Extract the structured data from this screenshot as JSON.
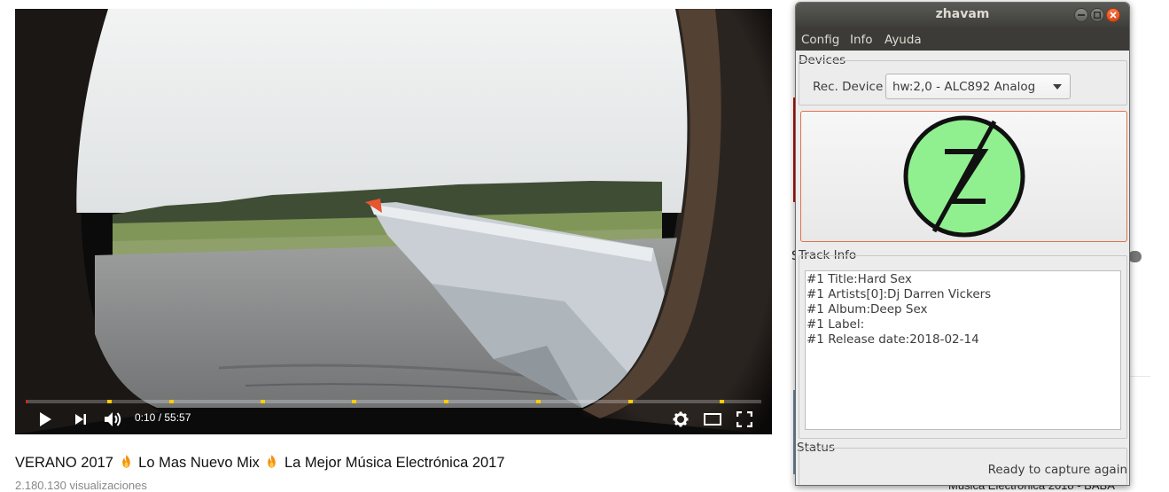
{
  "video": {
    "time_display": "0:10 / 55:57",
    "progress_fraction": 0.003,
    "title_parts": [
      "VERANO 2017",
      "Lo Mas Nuevo Mix",
      "La Mejor Música Electrónica 2017"
    ],
    "views_partial": "2.180.130 visualizaciones"
  },
  "icons": {
    "play": "play-icon",
    "next": "next-icon",
    "volume": "volume-icon",
    "settings": "gear-icon",
    "theater": "theater-mode-icon",
    "fullscreen": "fullscreen-icon",
    "emoji": "fire-emoji-icon"
  },
  "background_page": {
    "bottom_text": "Musica Electronica 2018 - BABA",
    "partial_letter": "S"
  },
  "window": {
    "title": "zhavam",
    "menu": [
      "Config",
      "Info",
      "Ayuda"
    ],
    "devices": {
      "group_label": "Devices",
      "rec_label": "Rec. Device",
      "selected_device": "hw:2,0 - ALC892 Analog"
    },
    "logo_letter": "Z",
    "track_info": {
      "group_label": "Track Info",
      "lines": [
        "#1 Title:Hard Sex",
        "#1 Artists[0]:Dj Darren Vickers",
        "#1 Album:Deep Sex",
        "#1 Label:",
        "#1 Release date:2018-02-14"
      ]
    },
    "status": {
      "group_label": "Status",
      "text": "Ready to capture again"
    }
  },
  "colors": {
    "progress_played": "#e62117",
    "chapter_marker": "#ffcc00",
    "logo_green": "#90f08f",
    "titlebar": "#3c3b37",
    "close_button": "#dd4814"
  }
}
